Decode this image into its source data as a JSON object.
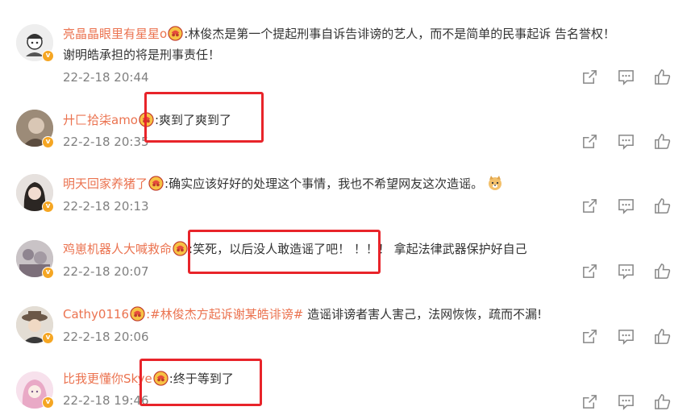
{
  "comments": [
    {
      "username": "亮晶晶眼里有星星o",
      "text_line1": ":林俊杰是第一个提起刑事自诉告诽谤的艺人，而不是简单的民事起诉 告名誉权！",
      "text_line2": "谢明皓承担的将是刑事责任！",
      "time": "22-2-18 20:44"
    },
    {
      "username": "廾匚拾柒amo",
      "text": ":爽到了爽到了",
      "time": "22-2-18 20:35"
    },
    {
      "username": "明天回家养猪了",
      "text": ":确实应该好好的处理这个事情，我也不希望网友这次造谣。",
      "time": "22-2-18 20:13"
    },
    {
      "username": "鸡崽机器人大喊救命",
      "text": ":笑死，以后没人敢造谣了吧！ ！！！ 拿起法律武器保护好自己",
      "time": "22-2-18 20:07"
    },
    {
      "username": "Cathy0116",
      "topic": ":#林俊杰方起诉谢某皓诽谤#",
      "text": " 造谣诽谤者害人害己，法网恢恢，疏而不漏!",
      "time": "22-2-18 20:06"
    },
    {
      "username": "比我更懂你Skye",
      "text": ":终于等到了",
      "time": "22-2-18 19:46"
    }
  ],
  "icons": {
    "share": "share-icon",
    "comment": "comment-icon",
    "like": "like-icon",
    "medal": "fan-medal-icon",
    "verified": "verified-badge-icon"
  },
  "colors": {
    "username": "#eb7350",
    "timestamp": "#808080",
    "highlight": "#e8242a",
    "verified": "#f5a623"
  }
}
